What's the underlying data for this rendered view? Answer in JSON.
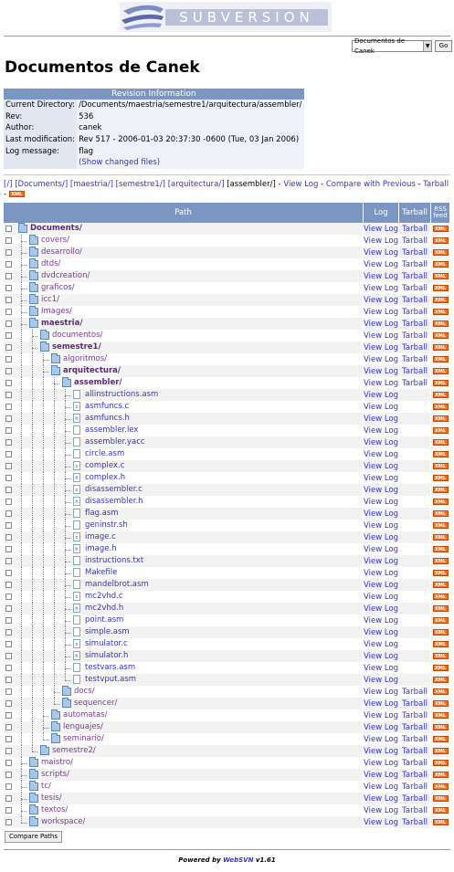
{
  "logo": {
    "text": "SUBVERSION"
  },
  "repo_selector": {
    "selected": "Documentos de Canek",
    "go_label": "Go"
  },
  "page_title": "Documentos de Canek",
  "revision_info": {
    "header": "Revision Information",
    "rows": [
      {
        "key": "Current Directory:",
        "value": "/Documents/maestria/semestre1/arquitectura/assembler/"
      },
      {
        "key": "Rev:",
        "value": "536"
      },
      {
        "key": "Author:",
        "value": "canek"
      },
      {
        "key": "Last modification:",
        "value": "Rev 517 - 2006-01-03 20:37:30 -0600 (Tue, 03 Jan 2006)"
      },
      {
        "key": "Log message:",
        "value": "flag"
      },
      {
        "key": "",
        "value": "(Show changed files)"
      }
    ]
  },
  "breadcrumb": {
    "links": [
      "[/]",
      "[Documents/]",
      "[maestria/]",
      "[semestre1/]",
      "[arquitectura/]"
    ],
    "current": "[assembler/]",
    "actions": [
      "View Log",
      "Compare with Previous",
      "Tarball"
    ],
    "xml": "XML"
  },
  "listing": {
    "headers": {
      "path": "Path",
      "log": "Log",
      "tarball": "Tarball",
      "rss": "RSS feed"
    },
    "view_log": "View Log",
    "tarball": "Tarball",
    "xml": "XML",
    "rows": [
      {
        "name": "Documents/",
        "level": 0,
        "type": "dir",
        "open": true,
        "last": false
      },
      {
        "name": "covers/",
        "level": 1,
        "type": "dir",
        "open": false,
        "last": false
      },
      {
        "name": "desarrollo/",
        "level": 1,
        "type": "dir",
        "open": false,
        "last": false
      },
      {
        "name": "dtds/",
        "level": 1,
        "type": "dir",
        "open": false,
        "last": false
      },
      {
        "name": "dvdcreation/",
        "level": 1,
        "type": "dir",
        "open": false,
        "last": false
      },
      {
        "name": "graficos/",
        "level": 1,
        "type": "dir",
        "open": false,
        "last": false
      },
      {
        "name": "icc1/",
        "level": 1,
        "type": "dir",
        "open": false,
        "last": false
      },
      {
        "name": "Images/",
        "level": 1,
        "type": "dir",
        "open": false,
        "last": false
      },
      {
        "name": "maestria/",
        "level": 1,
        "type": "dir",
        "open": true,
        "last": false
      },
      {
        "name": "documentos/",
        "level": 2,
        "type": "dir",
        "open": false,
        "last": false
      },
      {
        "name": "semestre1/",
        "level": 2,
        "type": "dir",
        "open": true,
        "last": false
      },
      {
        "name": "algoritmos/",
        "level": 3,
        "type": "dir",
        "open": false,
        "last": false
      },
      {
        "name": "arquitectura/",
        "level": 3,
        "type": "dir",
        "open": true,
        "last": false
      },
      {
        "name": "assembler/",
        "level": 4,
        "type": "dir",
        "open": true,
        "last": false
      },
      {
        "name": "allinstructions.asm",
        "level": 5,
        "type": "file",
        "ext": "",
        "last": false
      },
      {
        "name": "asmfuncs.c",
        "level": 5,
        "type": "file",
        "ext": "c",
        "last": false
      },
      {
        "name": "asmfuncs.h",
        "level": 5,
        "type": "file",
        "ext": "h",
        "last": false
      },
      {
        "name": "assembler.lex",
        "level": 5,
        "type": "file",
        "ext": "",
        "last": false
      },
      {
        "name": "assembler.yacc",
        "level": 5,
        "type": "file",
        "ext": "",
        "last": false
      },
      {
        "name": "circle.asm",
        "level": 5,
        "type": "file",
        "ext": "",
        "last": false
      },
      {
        "name": "complex.c",
        "level": 5,
        "type": "file",
        "ext": "c",
        "last": false
      },
      {
        "name": "complex.h",
        "level": 5,
        "type": "file",
        "ext": "h",
        "last": false
      },
      {
        "name": "disassembler.c",
        "level": 5,
        "type": "file",
        "ext": "c",
        "last": false
      },
      {
        "name": "disassembler.h",
        "level": 5,
        "type": "file",
        "ext": "h",
        "last": false
      },
      {
        "name": "flag.asm",
        "level": 5,
        "type": "file",
        "ext": "",
        "last": false
      },
      {
        "name": "geninstr.sh",
        "level": 5,
        "type": "file",
        "ext": "",
        "last": false
      },
      {
        "name": "image.c",
        "level": 5,
        "type": "file",
        "ext": "c",
        "last": false
      },
      {
        "name": "image.h",
        "level": 5,
        "type": "file",
        "ext": "h",
        "last": false
      },
      {
        "name": "instructions.txt",
        "level": 5,
        "type": "file",
        "ext": "",
        "last": false
      },
      {
        "name": "Makefile",
        "level": 5,
        "type": "file",
        "ext": "",
        "last": false
      },
      {
        "name": "mandelbrot.asm",
        "level": 5,
        "type": "file",
        "ext": "",
        "last": false
      },
      {
        "name": "mc2vhd.c",
        "level": 5,
        "type": "file",
        "ext": "c",
        "last": false
      },
      {
        "name": "mc2vhd.h",
        "level": 5,
        "type": "file",
        "ext": "h",
        "last": false
      },
      {
        "name": "point.asm",
        "level": 5,
        "type": "file",
        "ext": "",
        "last": false
      },
      {
        "name": "simple.asm",
        "level": 5,
        "type": "file",
        "ext": "",
        "last": false
      },
      {
        "name": "simulator.c",
        "level": 5,
        "type": "file",
        "ext": "c",
        "last": false
      },
      {
        "name": "simulator.h",
        "level": 5,
        "type": "file",
        "ext": "h",
        "last": false
      },
      {
        "name": "testvars.asm",
        "level": 5,
        "type": "file",
        "ext": "",
        "last": false
      },
      {
        "name": "testvput.asm",
        "level": 5,
        "type": "file",
        "ext": "",
        "last": true
      },
      {
        "name": "docs/",
        "level": 4,
        "type": "dir",
        "open": false,
        "last": false
      },
      {
        "name": "sequencer/",
        "level": 4,
        "type": "dir",
        "open": false,
        "last": true
      },
      {
        "name": "automatas/",
        "level": 3,
        "type": "dir",
        "open": false,
        "last": false
      },
      {
        "name": "lenguajes/",
        "level": 3,
        "type": "dir",
        "open": false,
        "last": false
      },
      {
        "name": "seminario/",
        "level": 3,
        "type": "dir",
        "open": false,
        "last": true
      },
      {
        "name": "semestre2/",
        "level": 2,
        "type": "dir",
        "open": false,
        "last": true
      },
      {
        "name": "maistro/",
        "level": 1,
        "type": "dir",
        "open": false,
        "last": false
      },
      {
        "name": "scripts/",
        "level": 1,
        "type": "dir",
        "open": false,
        "last": false
      },
      {
        "name": "tc/",
        "level": 1,
        "type": "dir",
        "open": false,
        "last": false
      },
      {
        "name": "tesis/",
        "level": 1,
        "type": "dir",
        "open": false,
        "last": false
      },
      {
        "name": "textos/",
        "level": 1,
        "type": "dir",
        "open": false,
        "last": false
      },
      {
        "name": "workspace/",
        "level": 1,
        "type": "dir",
        "open": false,
        "last": true
      }
    ]
  },
  "compare_button": "Compare Paths",
  "footer": {
    "prefix": "Powered by",
    "brand": "WebSVN",
    "version": "v1.61"
  },
  "colors": {
    "header_bg": "#7c96c4",
    "link": "#3333cc",
    "xml_badge": "#f86c1c"
  }
}
